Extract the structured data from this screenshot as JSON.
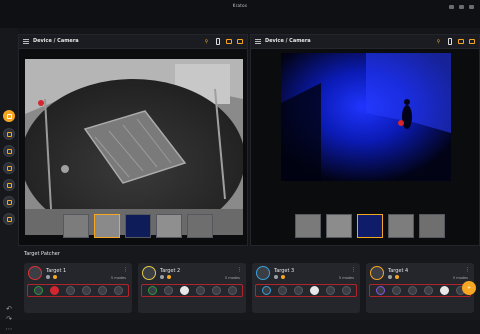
{
  "app": {
    "title": "Kratos"
  },
  "panels": [
    {
      "title": "Device / Camera"
    },
    {
      "title": "Device / Camera"
    }
  ],
  "patcher": {
    "title": "Target Patcher",
    "cards": [
      {
        "name": "Target 1",
        "meta": "5 modes"
      },
      {
        "name": "Target 2",
        "meta": "5 modes"
      },
      {
        "name": "Target 3",
        "meta": "5 modes"
      },
      {
        "name": "Target 4",
        "meta": "5 modes"
      }
    ]
  },
  "colors": {
    "accent": "#f5a623",
    "alert": "#d3262f",
    "background": "#141519",
    "panel": "#1b1c21"
  },
  "icons": {
    "toolbar": [
      "pencil-icon",
      "target-icon",
      "camera-icon",
      "target-icon",
      "frame-icon",
      "settings-icon",
      "list-icon"
    ],
    "header": [
      "person-icon",
      "phone-icon",
      "camera-icon",
      "frame-icon"
    ],
    "bottom": [
      "undo-icon",
      "redo-icon",
      "more-icon"
    ]
  }
}
